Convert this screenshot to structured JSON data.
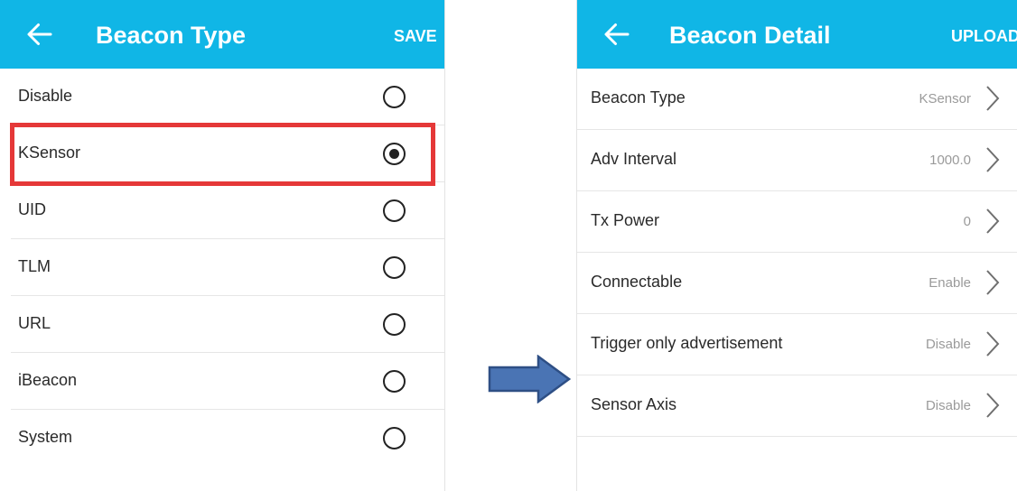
{
  "left_screen": {
    "title": "Beacon Type",
    "action": "SAVE",
    "options": [
      {
        "label": "Disable",
        "selected": false
      },
      {
        "label": "KSensor",
        "selected": true
      },
      {
        "label": "UID",
        "selected": false
      },
      {
        "label": "TLM",
        "selected": false
      },
      {
        "label": "URL",
        "selected": false
      },
      {
        "label": "iBeacon",
        "selected": false
      },
      {
        "label": "System",
        "selected": false
      }
    ]
  },
  "right_screen": {
    "title": "Beacon Detail",
    "action": "UPLOAD",
    "rows": [
      {
        "label": "Beacon Type",
        "value": "KSensor"
      },
      {
        "label": "Adv Interval",
        "value": "1000.0"
      },
      {
        "label": "Tx Power",
        "value": "0"
      },
      {
        "label": "Connectable",
        "value": "Enable"
      },
      {
        "label": "Trigger only advertisement",
        "value": "Disable"
      },
      {
        "label": "Sensor Axis",
        "value": "Disable"
      }
    ]
  },
  "colors": {
    "appbar": "#10b6e6",
    "highlight": "#e53838",
    "arrow_fill": "#4a74b4",
    "arrow_stroke": "#2e4f85"
  },
  "icons": {
    "back": "arrow-left-icon",
    "radio": "radio-button-icon",
    "chevron": "chevron-right-icon",
    "transition": "arrow-right-icon"
  }
}
